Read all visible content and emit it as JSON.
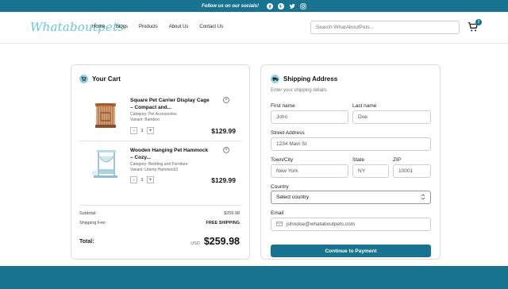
{
  "topbar": {
    "follow_text": "Follow us on our socials!",
    "icons": [
      "facebook-icon",
      "pinterest-icon",
      "twitter-icon",
      "instagram-icon"
    ]
  },
  "header": {
    "logo": "Whataboutpets",
    "nav": [
      "Home",
      "Blogs",
      "Products",
      "About Us",
      "Contact Us"
    ],
    "search_placeholder": "Search WhatAboutPets...",
    "cart_count": "2"
  },
  "cart": {
    "title": "Your Cart",
    "items": [
      {
        "name": "Square Pet Carrier Display Cage – Compact and...",
        "category": "Category: Pet Accessories",
        "variant": "Variant: Bamboo",
        "qty": "1",
        "price": "$129.99"
      },
      {
        "name": "Wooden Hanging Pet Hammock – Cozy...",
        "category": "Category: Bedding and Furniture",
        "variant": "Variant: Liberty Hammock3",
        "qty": "1",
        "price": "$129.99"
      }
    ],
    "subtotal_label": "Subtotal:",
    "subtotal_value": "$259.98",
    "shipping_label": "Shipping Fee:",
    "shipping_value": "FREE SHIPPING",
    "total_label": "Total:",
    "currency": "USD",
    "total_value": "$259.98"
  },
  "shipping": {
    "title": "Shipping Address",
    "subtitle": "Enter your shipping details",
    "first_name_label": "First name",
    "first_name": "John",
    "last_name_label": "Last name",
    "last_name": "Doe",
    "street_label": "Street Address",
    "street": "1234 Main St",
    "city_label": "Town/City",
    "city": "New York",
    "state_label": "State",
    "state": "NY",
    "zip_label": "ZIP",
    "zip": "10001",
    "country_label": "Country",
    "country": "Select country",
    "email_label": "Email",
    "email": "johndoe@whataboutpets.com",
    "continue_label": "Continue to Payment"
  },
  "colors": {
    "brand": "#17738f",
    "logo": "#66c8dc",
    "icon_bg": "#8fd4e3"
  }
}
